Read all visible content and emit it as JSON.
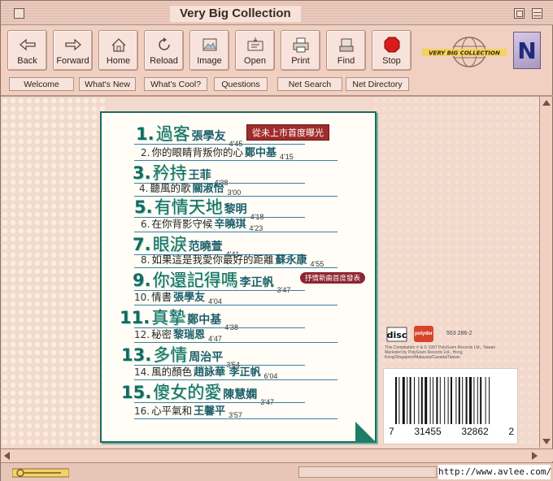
{
  "window": {
    "title": "Very Big Collection"
  },
  "toolbar": {
    "buttons": [
      {
        "label": "Back",
        "icon": "back-arrow-icon"
      },
      {
        "label": "Forward",
        "icon": "forward-arrow-icon"
      },
      {
        "label": "Home",
        "icon": "home-icon"
      },
      {
        "label": "Reload",
        "icon": "reload-icon"
      },
      {
        "label": "Image",
        "icon": "image-icon"
      },
      {
        "label": "Open",
        "icon": "open-icon"
      },
      {
        "label": "Print",
        "icon": "printer-icon"
      },
      {
        "label": "Find",
        "icon": "find-icon"
      },
      {
        "label": "Stop",
        "icon": "stop-icon"
      }
    ],
    "logo_letter": "N"
  },
  "directory": {
    "buttons": [
      "Welcome",
      "What's New",
      "What's Cool?",
      "Questions",
      "Net Search",
      "Net Directory"
    ]
  },
  "tracks": [
    {
      "num": "1.",
      "title": "過客",
      "artist": "張學友",
      "duration": "4'45",
      "style": "big"
    },
    {
      "num": "2.",
      "title": "你的眼睛背叛你的心",
      "artist": "鄭中基",
      "duration": "4'15",
      "style": "small"
    },
    {
      "num": "3.",
      "title": "矜持",
      "artist": "王菲",
      "duration": "4'38",
      "style": "big"
    },
    {
      "num": "4.",
      "title": "聽風的歌",
      "artist": "關淑怡",
      "duration": "3'00",
      "style": "small"
    },
    {
      "num": "5.",
      "title": "有情天地",
      "artist": "黎明",
      "duration": "4'18",
      "style": "big"
    },
    {
      "num": "6.",
      "title": "在你背影守候",
      "artist": "辛曉琪",
      "duration": "4'23",
      "style": "small"
    },
    {
      "num": "7.",
      "title": "眼淚",
      "artist": "范曉萱",
      "duration": "4'41",
      "style": "big"
    },
    {
      "num": "8.",
      "title": "如果這是我愛你最好的距離",
      "artist": "蘇永康",
      "duration": "4'55",
      "style": "small"
    },
    {
      "num": "9.",
      "title": "你還記得嗎",
      "artist": "李正帆",
      "duration": "3'47",
      "style": "big"
    },
    {
      "num": "10.",
      "title": "情書",
      "artist": "張學友",
      "duration": "4'04",
      "style": "small"
    },
    {
      "num": "11.",
      "title": "真摯",
      "artist": "鄭中基",
      "duration": "4'38",
      "style": "big"
    },
    {
      "num": "12.",
      "title": "秘密",
      "artist": "黎瑞恩",
      "duration": "4'47",
      "style": "small"
    },
    {
      "num": "13.",
      "title": "多情",
      "artist": "周治平",
      "duration": "3'54",
      "style": "big"
    },
    {
      "num": "14.",
      "title": "風的顏色",
      "artist": "趙詠華 李正帆",
      "duration": "6'04",
      "style": "small"
    },
    {
      "num": "15.",
      "title": "傻女的愛",
      "artist": "陳慧嫻",
      "duration": "3'47",
      "style": "big"
    },
    {
      "num": "16.",
      "title": "心平氣和",
      "artist": "王馨平",
      "duration": "3'57",
      "style": "small"
    }
  ],
  "badges": {
    "unreleased": "從未上市首度曝光",
    "new_song": "抒情新曲首度發表"
  },
  "back_cover": {
    "catalog_no": "553 286-2",
    "compact_disc": "COMPACT DIGITAL AUDIO",
    "label_logo": "polydor",
    "fineprint_1": "This Compilation ℗ & © 1997 PolyGram Records Ltd., Taiwan",
    "fineprint_2": "Marketed by PolyGram Records Ltd., Hong Kong/Singapore/Malaysia/Canada/Taiwan",
    "barcode_digits": [
      "7",
      "31455",
      "32862",
      "2"
    ]
  },
  "statusbar": {
    "watermark": "http://www.avlee.com/"
  },
  "colors": {
    "chrome": "#f1cfc1",
    "accent_teal": "#136b62",
    "rule_blue": "#3a7fa7",
    "badge_red": "#a12b2b"
  }
}
